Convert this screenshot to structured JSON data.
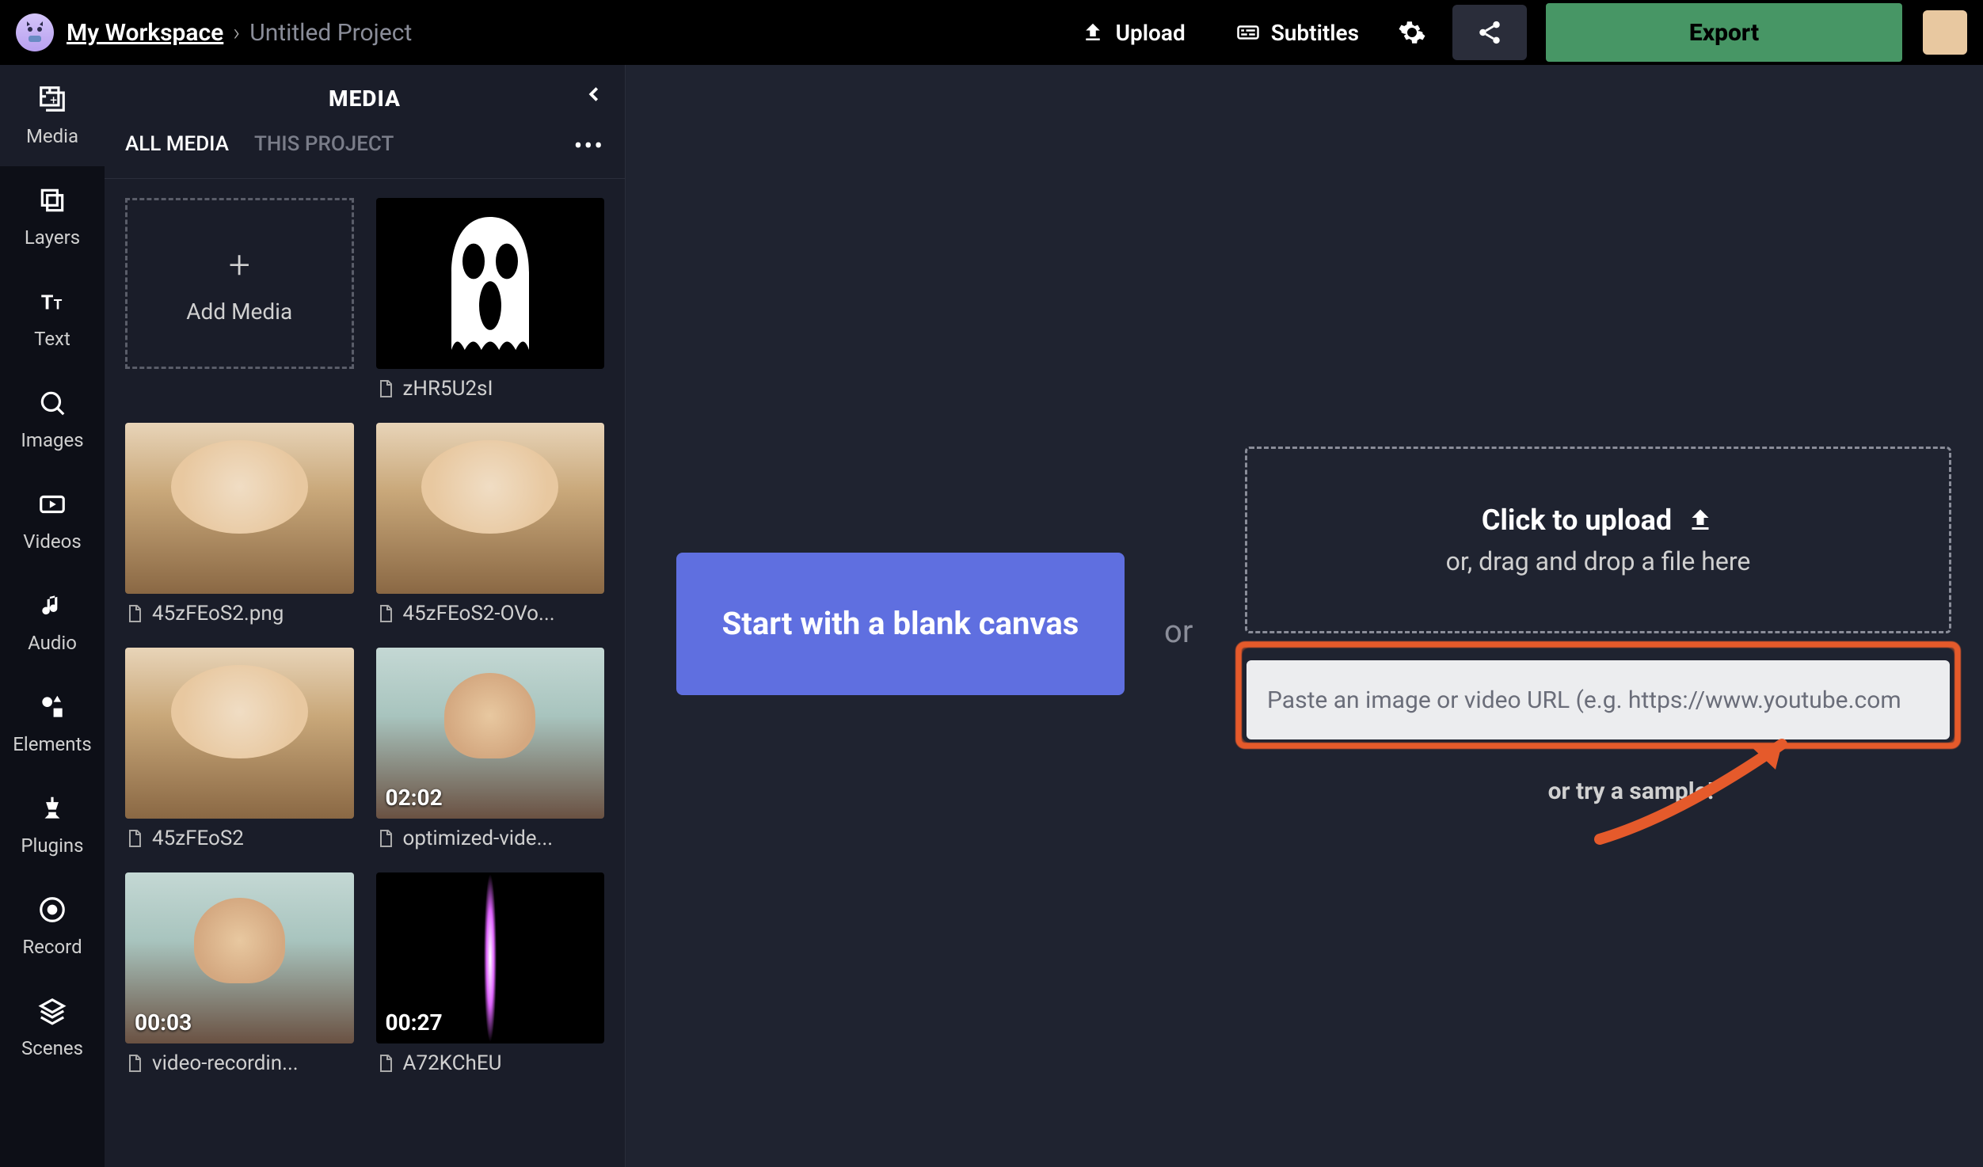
{
  "header": {
    "workspace_label": "My Workspace",
    "project_label": "Untitled Project",
    "upload_label": "Upload",
    "subtitles_label": "Subtitles",
    "export_label": "Export"
  },
  "sidebar": {
    "items": [
      {
        "label": "Media",
        "icon": "media"
      },
      {
        "label": "Layers",
        "icon": "layers"
      },
      {
        "label": "Text",
        "icon": "text"
      },
      {
        "label": "Images",
        "icon": "images"
      },
      {
        "label": "Videos",
        "icon": "videos"
      },
      {
        "label": "Audio",
        "icon": "audio"
      },
      {
        "label": "Elements",
        "icon": "elements"
      },
      {
        "label": "Plugins",
        "icon": "plugins"
      },
      {
        "label": "Record",
        "icon": "record"
      },
      {
        "label": "Scenes",
        "icon": "scenes"
      }
    ],
    "active_index": 0
  },
  "media_panel": {
    "title": "MEDIA",
    "tabs": [
      "ALL MEDIA",
      "THIS PROJECT"
    ],
    "active_tab": 0,
    "add_tile_label": "Add Media",
    "items": [
      {
        "name": "zHR5U2sI",
        "thumb": "ghost",
        "duration": null
      },
      {
        "name": "45zFEoS2.png",
        "thumb": "baby",
        "duration": null
      },
      {
        "name": "45zFEoS2-OVo...",
        "thumb": "baby",
        "duration": null
      },
      {
        "name": "45zFEoS2",
        "thumb": "baby",
        "duration": null
      },
      {
        "name": "optimized-vide...",
        "thumb": "person",
        "duration": "02:02"
      },
      {
        "name": "video-recordin...",
        "thumb": "person",
        "duration": "00:03"
      },
      {
        "name": "A72KChEU",
        "thumb": "saber",
        "duration": "00:27"
      }
    ]
  },
  "canvas": {
    "start_blank_label": "Start with a blank canvas",
    "or_label": "or",
    "upload_title": "Click to upload",
    "upload_sub": "or, drag and drop a file here",
    "url_placeholder": "Paste an image or video URL (e.g. https://www.youtube.com",
    "try_sample_label": "or try a sample!"
  }
}
